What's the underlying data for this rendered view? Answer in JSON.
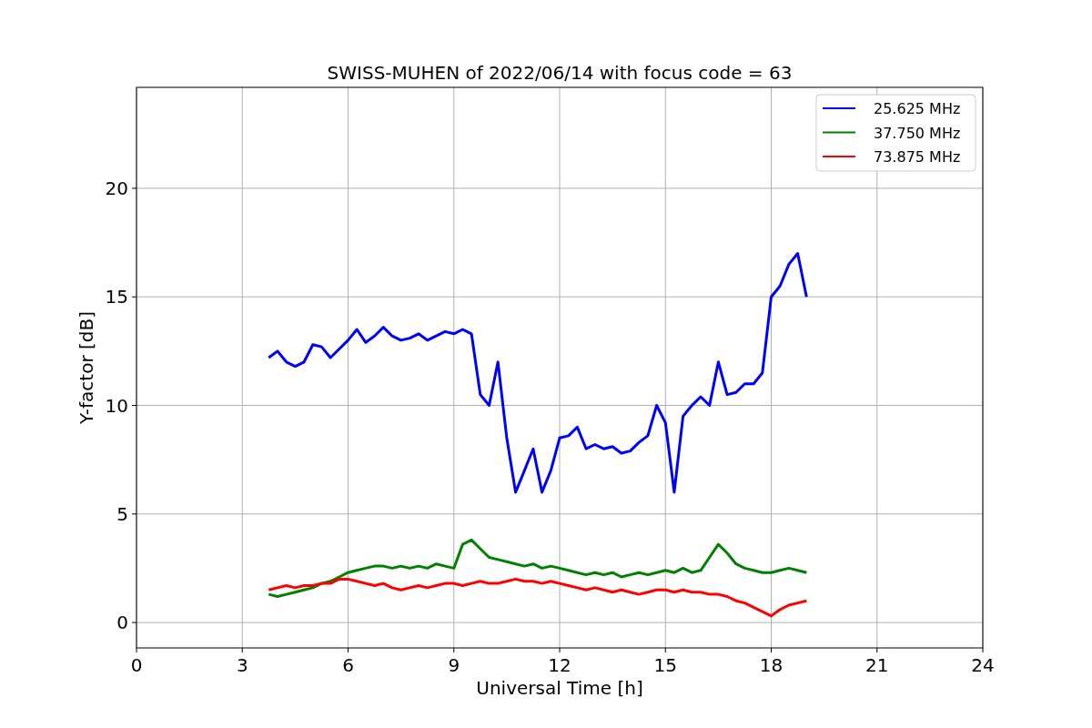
{
  "chart_data": {
    "type": "line",
    "title": "SWISS-MUHEN of 2022/06/14 with focus code = 63",
    "xlabel": "Universal Time [h]",
    "ylabel": "Y-factor [dB]",
    "xlim": [
      0,
      24
    ],
    "ylim": [
      -1.17,
      24.65
    ],
    "xticks": [
      0,
      3,
      6,
      9,
      12,
      15,
      18,
      21,
      24
    ],
    "yticks": [
      0,
      5,
      10,
      15,
      20
    ],
    "grid": true,
    "legend": true,
    "x": [
      3.75,
      4,
      4.25,
      4.5,
      4.75,
      5,
      5.25,
      5.5,
      5.75,
      6,
      6.25,
      6.5,
      6.75,
      7,
      7.25,
      7.5,
      7.75,
      8,
      8.25,
      8.5,
      8.75,
      9,
      9.25,
      9.5,
      9.75,
      10,
      10.25,
      10.5,
      10.75,
      11,
      11.25,
      11.5,
      11.75,
      12,
      12.25,
      12.5,
      12.75,
      13,
      13.25,
      13.5,
      13.75,
      14,
      14.25,
      14.5,
      14.75,
      15,
      15.25,
      15.5,
      15.75,
      16,
      16.25,
      16.5,
      16.75,
      17,
      17.25,
      17.5,
      17.75,
      18,
      18.25,
      18.5,
      18.75,
      19
    ],
    "series": [
      {
        "name": "25.625 MHz",
        "color": "#0000ff",
        "values": [
          12.2,
          12.5,
          12.0,
          11.8,
          12.0,
          12.8,
          12.7,
          12.2,
          12.6,
          13.0,
          13.5,
          12.9,
          13.2,
          13.6,
          13.2,
          13.0,
          13.1,
          13.3,
          13.0,
          13.2,
          13.4,
          13.3,
          13.5,
          13.3,
          10.5,
          10.0,
          12.0,
          8.5,
          6.0,
          7.0,
          8.0,
          6.0,
          7.0,
          8.5,
          8.6,
          9.0,
          8.0,
          8.2,
          8.0,
          8.1,
          7.8,
          7.9,
          8.3,
          8.6,
          10.0,
          9.2,
          6.0,
          9.5,
          10.0,
          10.4,
          10.0,
          12.0,
          10.5,
          10.6,
          11.0,
          11.0,
          11.5,
          15.0,
          15.5,
          16.5,
          17.0,
          15.0
        ]
      },
      {
        "name": "37.750 MHz",
        "color": "#008000",
        "values": [
          1.3,
          1.2,
          1.3,
          1.4,
          1.5,
          1.6,
          1.8,
          1.9,
          2.1,
          2.3,
          2.4,
          2.5,
          2.6,
          2.6,
          2.5,
          2.6,
          2.5,
          2.6,
          2.5,
          2.7,
          2.6,
          2.5,
          3.6,
          3.8,
          3.4,
          3.0,
          2.9,
          2.8,
          2.7,
          2.6,
          2.7,
          2.5,
          2.6,
          2.5,
          2.4,
          2.3,
          2.2,
          2.3,
          2.2,
          2.3,
          2.1,
          2.2,
          2.3,
          2.2,
          2.3,
          2.4,
          2.3,
          2.5,
          2.3,
          2.4,
          3.0,
          3.6,
          3.2,
          2.7,
          2.5,
          2.4,
          2.3,
          2.3,
          2.4,
          2.5,
          2.4,
          2.3
        ]
      },
      {
        "name": "73.875 MHz",
        "color": "#ff0000",
        "values": [
          1.5,
          1.6,
          1.7,
          1.6,
          1.7,
          1.7,
          1.8,
          1.8,
          2.0,
          2.0,
          1.9,
          1.8,
          1.7,
          1.8,
          1.6,
          1.5,
          1.6,
          1.7,
          1.6,
          1.7,
          1.8,
          1.8,
          1.7,
          1.8,
          1.9,
          1.8,
          1.8,
          1.9,
          2.0,
          1.9,
          1.9,
          1.8,
          1.9,
          1.8,
          1.7,
          1.6,
          1.5,
          1.6,
          1.5,
          1.4,
          1.5,
          1.4,
          1.3,
          1.4,
          1.5,
          1.5,
          1.4,
          1.5,
          1.4,
          1.4,
          1.3,
          1.3,
          1.2,
          1.0,
          0.9,
          0.7,
          0.5,
          0.3,
          0.6,
          0.8,
          0.9,
          1.0
        ]
      }
    ]
  }
}
